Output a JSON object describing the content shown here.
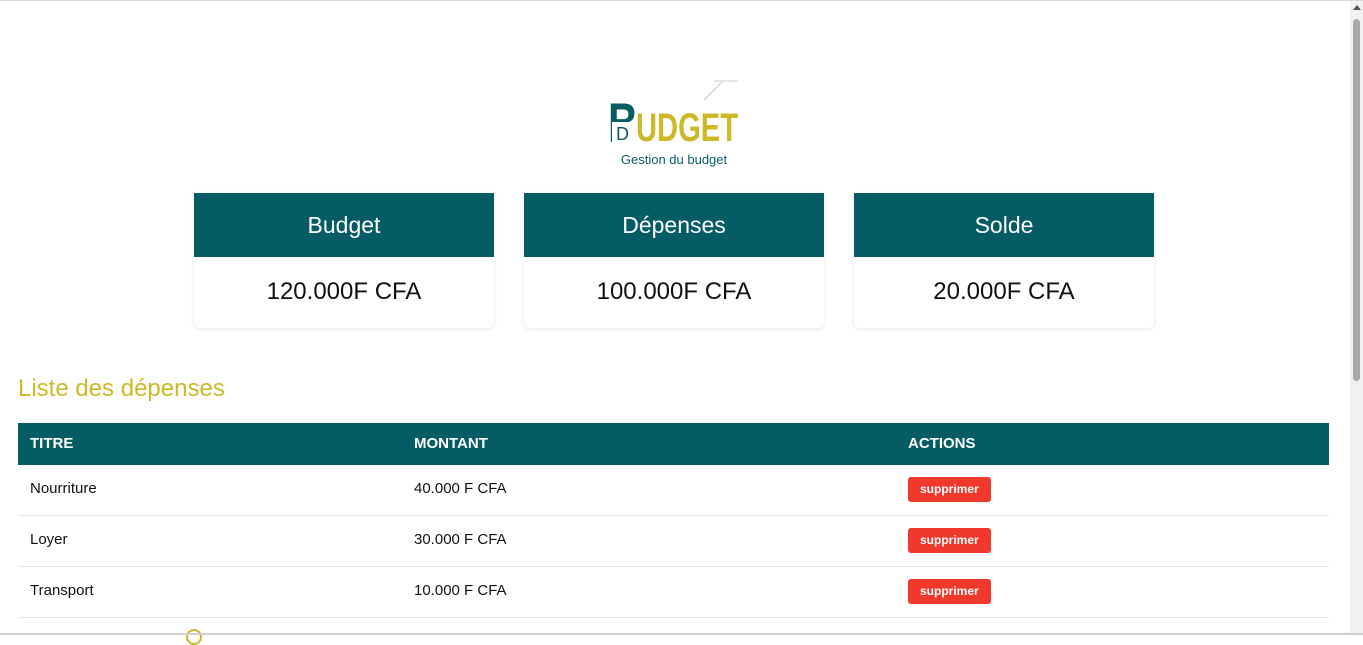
{
  "header": {
    "logo_first_letter": "B",
    "logo_rest": "UDGET",
    "logo_inner_letter": "D",
    "tagline": "Gestion du budget"
  },
  "cards": [
    {
      "title": "Budget",
      "value": "120.000F CFA"
    },
    {
      "title": "Dépenses",
      "value": "100.000F CFA"
    },
    {
      "title": "Solde",
      "value": "20.000F CFA"
    }
  ],
  "expenses": {
    "title": "Liste des dépenses",
    "columns": [
      "TITRE",
      "MONTANT",
      "ACTIONS"
    ],
    "rows": [
      {
        "titre": "Nourriture",
        "montant": "40.000 F CFA",
        "action": "supprimer"
      },
      {
        "titre": "Loyer",
        "montant": "30.000 F CFA",
        "action": "supprimer"
      },
      {
        "titre": "Transport",
        "montant": "10.000 F CFA",
        "action": "supprimer"
      }
    ]
  },
  "colors": {
    "primary": "#055c64",
    "accent": "#cdb928",
    "danger": "#f0382d"
  }
}
